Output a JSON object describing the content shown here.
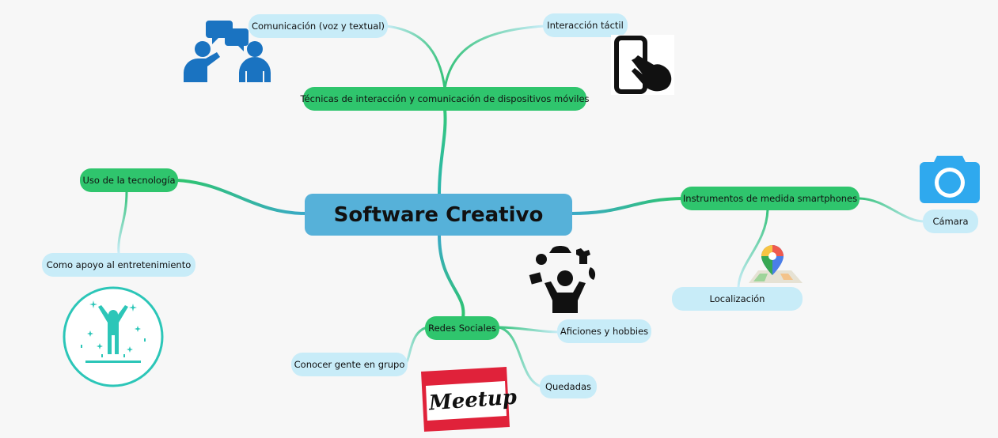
{
  "central": {
    "label": "Software Creativo"
  },
  "branches": {
    "tecnicas": {
      "label": "Técnicas de interacción y comunicación de dispositivos móviles"
    },
    "comunicacion": {
      "label": "Comunicación (voz y textual)"
    },
    "interaccion": {
      "label": "Interacción táctil"
    },
    "uso": {
      "label": "Uso de la tecnología"
    },
    "apoyo": {
      "label": "Como apoyo al entretenimiento"
    },
    "instrumentos": {
      "label": "Instrumentos de medida smartphones"
    },
    "camara": {
      "label": "Cámara"
    },
    "localizacion": {
      "label": "Localización"
    },
    "redes": {
      "label": "Redes Sociales"
    },
    "aficiones": {
      "label": "Aficiones y hobbies"
    },
    "conocer": {
      "label": "Conocer gente en grupo"
    },
    "quedadas": {
      "label": "Quedadas"
    }
  },
  "logo": {
    "text": "Meetup"
  },
  "colors": {
    "central": "#56b1d9",
    "branch": "#2fc56d",
    "leaf": "#c8ecf8",
    "link": "#35b9a8",
    "icon_blue": "#1a73c1",
    "icon_teal": "#2cc6b8",
    "icon_red": "#e0223a"
  },
  "icons": [
    "people-chat-icon",
    "phone-touch-icon",
    "camera-icon",
    "map-pin-icon",
    "juggler-icon",
    "celebration-icon",
    "meetup-logo"
  ]
}
